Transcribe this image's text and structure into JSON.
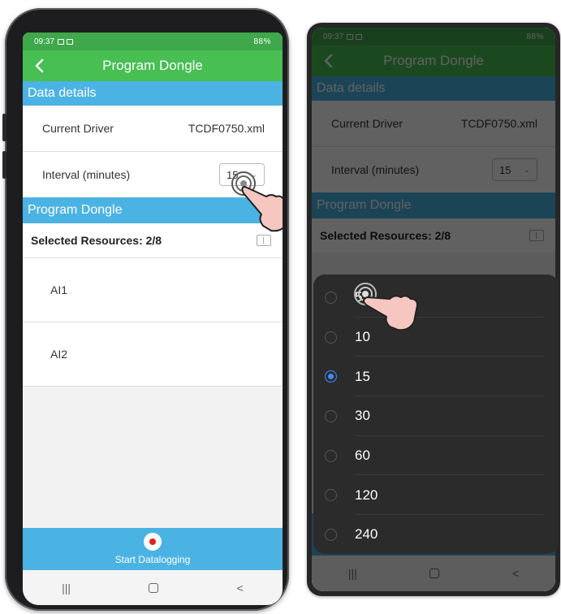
{
  "status": {
    "time": "09:37",
    "battery": "88%"
  },
  "appbar": {
    "title": "Program Dongle",
    "back_icon": "chevron-left-icon"
  },
  "data_details": {
    "header": "Data details",
    "current_driver_label": "Current Driver",
    "current_driver_value": "TCDF0750.xml",
    "interval_label": "Interval (minutes)",
    "interval_value": "15"
  },
  "program_dongle": {
    "header": "Program Dongle",
    "selected_resources": "Selected Resources: 2/8",
    "items": [
      "AI1",
      "AI2"
    ]
  },
  "footer": {
    "start_label": "Start Datalogging"
  },
  "navbar": {
    "recents": "|||",
    "back": "<"
  },
  "interval_options": {
    "items": [
      "5",
      "10",
      "15",
      "30",
      "60",
      "120",
      "240"
    ],
    "selected": "15",
    "selected_color": "#3d8bff"
  },
  "colors": {
    "status_green": "#3fa84a",
    "appbar_green": "#47bf52",
    "section_blue": "#4bb3e4"
  }
}
